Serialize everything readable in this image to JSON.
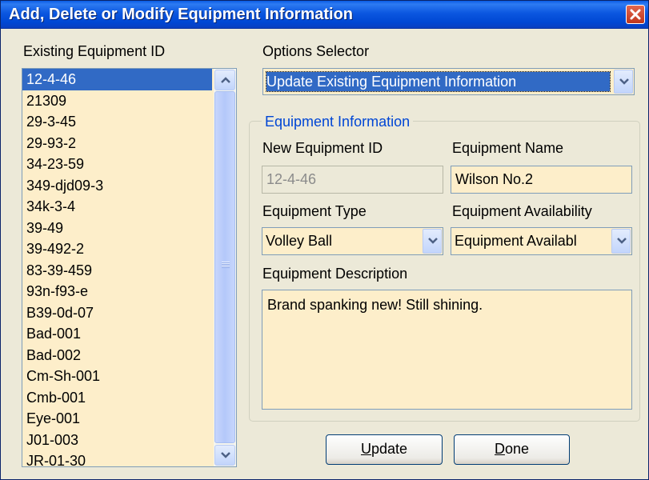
{
  "window": {
    "title": "Add, Delete or Modify Equipment Information"
  },
  "left": {
    "label": "Existing Equipment ID",
    "items": [
      "12-4-46",
      "21309",
      "29-3-45",
      "29-93-2",
      "34-23-59",
      "349-djd09-3",
      "34k-3-4",
      "39-49",
      "39-492-2",
      "83-39-459",
      "93n-f93-e",
      "B39-0d-07",
      "Bad-001",
      "Bad-002",
      "Cm-Sh-001",
      "Cmb-001",
      "Eye-001",
      "J01-003",
      "JR-01-30"
    ],
    "selected_index": 0
  },
  "options": {
    "label": "Options Selector",
    "value": "Update Existing Equipment Information"
  },
  "group": {
    "title": "Equipment Information",
    "new_id_label": "New Equipment ID",
    "new_id_value": "12-4-46",
    "name_label": "Equipment Name",
    "name_value": "Wilson No.2",
    "type_label": "Equipment Type",
    "type_value": "Volley Ball",
    "availability_label": "Equipment Availability",
    "availability_value": "Equipment Availabl",
    "description_label": "Equipment Description",
    "description_value": "Brand spanking new! Still shining."
  },
  "buttons": {
    "update_mnemonic": "U",
    "update_rest": "pdate",
    "done_mnemonic": "D",
    "done_rest": "one"
  },
  "icons": {
    "close": "close-icon",
    "scroll_up": "chevron-up-icon",
    "scroll_down": "chevron-down-icon",
    "dropdown": "chevron-down-icon"
  },
  "colors": {
    "title_bar": "#0a5ce6",
    "field_bg": "#fdeeca",
    "selection": "#316ac5",
    "group_title": "#0046d5",
    "close": "#c0361c"
  }
}
